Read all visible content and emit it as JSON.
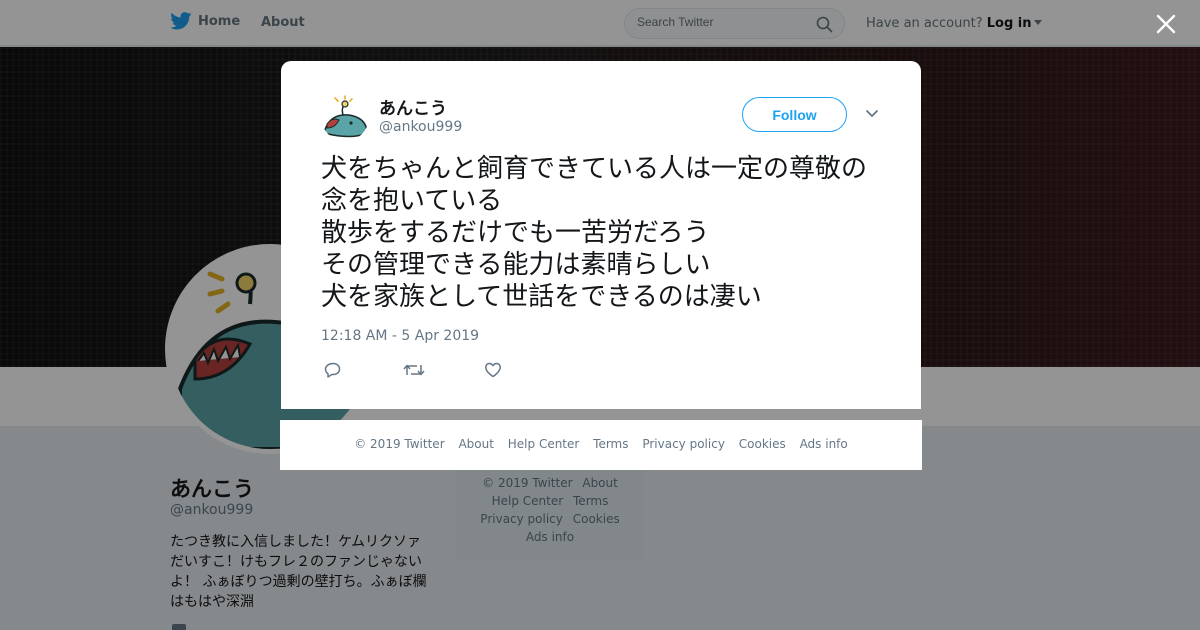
{
  "nav": {
    "home_label": "Home",
    "about_label": "About",
    "search_placeholder": "Search Twitter",
    "account_prompt": "Have an account?",
    "login_label": "Log in"
  },
  "profile": {
    "name": "あんこう",
    "handle": "@ankou999",
    "bio": "たつき教に入信しました！ケムリクソァだいすこ！けもフレ２のファンじゃないよ！ ふぁぼりつ過剰の壁打ち。ふぁぼ欄はもはや深淵"
  },
  "side_footer": {
    "links": [
      "© 2019 Twitter",
      "About",
      "Help Center",
      "Terms",
      "Privacy policy",
      "Cookies",
      "Ads info"
    ]
  },
  "tweet": {
    "author_name": "あんこう",
    "author_handle": "@ankou999",
    "follow_label": "Follow",
    "text": "犬をちゃんと飼育できている人は一定の尊敬の念を抱いている\n散歩をするだけでも一苦労だろう\nその管理できる能力は素晴らしい\n犬を家族として世話をできるのは凄い",
    "timestamp": "12:18 AM - 5 Apr 2019"
  },
  "modal_footer": {
    "links": [
      "© 2019 Twitter",
      "About",
      "Help Center",
      "Terms",
      "Privacy policy",
      "Cookies",
      "Ads info"
    ]
  },
  "icons": {
    "brand": "twitter-bird-icon",
    "search": "search-icon",
    "close": "close-icon",
    "menu": "chevron-down-icon",
    "reply": "reply-icon",
    "retweet": "retweet-icon",
    "like": "heart-icon"
  },
  "colors": {
    "brand_blue": "#1da1f2",
    "text_primary": "#14171a",
    "text_secondary": "#657786",
    "avatar_fish": "#5aa3a6"
  }
}
